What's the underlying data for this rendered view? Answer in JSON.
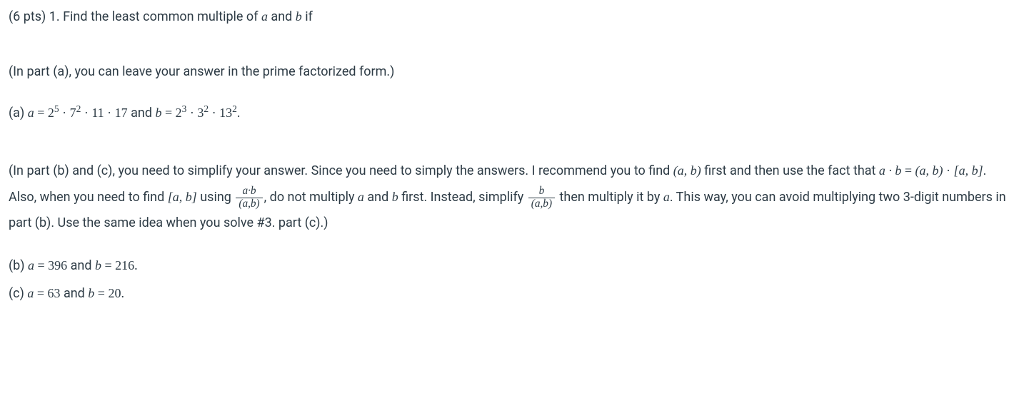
{
  "header": {
    "points": "(6 pts)",
    "number": "1.",
    "prompt_pre": "Find the least common multiple of ",
    "a": "a",
    "and": " and ",
    "b": "b",
    "if": " if"
  },
  "noteA": "(In part (a), you can leave your answer in the prime factorized form.)",
  "partA": {
    "label": "(a) ",
    "a_eq": "a",
    "eq1": " = ",
    "expr_a": "2⁵ · 7² · 11 · 17",
    "and": " and ",
    "b_eq": "b",
    "eq2": " = ",
    "expr_b": "2³ · 3² · 13²."
  },
  "noteBC": {
    "t1": "(In part (b) and (c), you need to simplify your answer. Since you need to simply the answers. I recommend you to find ",
    "pair1": "(a, b)",
    "t2": " first and then use the fact that ",
    "ab": "a · b",
    "eq": " = ",
    "pair2": "(a, b)",
    "dot": " · ",
    "brack1": "[a, b]",
    "t3": ". Also, when you need to find ",
    "brack2": "[a, b]",
    "t4": " using ",
    "frac1_num": "a·b",
    "frac1_den": "(a,b)",
    "t5": ", do not multiply ",
    "a": "a",
    "and": " and ",
    "b": "b",
    "t6": " first. Instead, simplify ",
    "frac2_num": "b",
    "frac2_den": "(a,b)",
    "t7": " then multiply it by ",
    "a2": "a",
    "t8": ". This way, you can avoid multiplying two 3-digit numbers in part (b). Use the same idea when you solve #3. part (c).)"
  },
  "partB": {
    "label": "(b) ",
    "a": "a",
    "eq1": " = ",
    "val_a": "396",
    "and": " and ",
    "b": "b",
    "eq2": " = ",
    "val_b": "216."
  },
  "partC": {
    "label": "(c) ",
    "a": "a",
    "eq1": " = ",
    "val_a": "63",
    "and": " and ",
    "b": "b",
    "eq2": " = ",
    "val_b": "20."
  }
}
